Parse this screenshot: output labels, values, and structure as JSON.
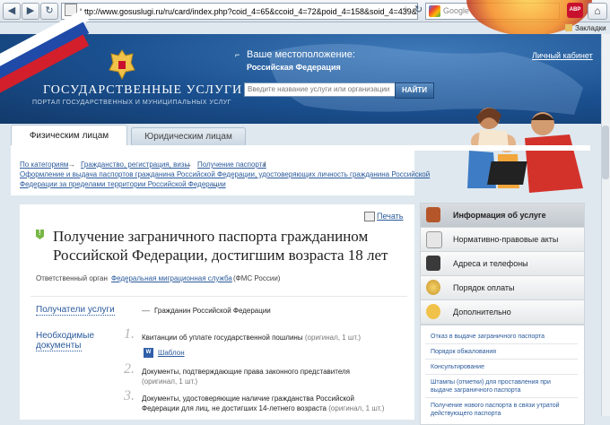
{
  "browser": {
    "url": "http://www.gosuslugi.ru/ru/card/index.php?coid_4=65&ccoid_4=72&poid_4=158&soid_4=439&tc",
    "search_placeholder": "Google",
    "addon_label": "ABP",
    "bookmarks_label": "Закладки"
  },
  "header": {
    "title": "ГОСУДАРСТВЕННЫЕ УСЛУГИ",
    "subtitle": "ПОРТАЛ ГОСУДАРСТВЕННЫХ И МУНИЦИПАЛЬНЫХ УСЛУГ",
    "location_label": "Ваше местоположение:",
    "location_value": "Российская Федерация",
    "cabinet_link": "Личный кабинет",
    "search_placeholder": "Введите название услуги или организации",
    "search_button": "НАЙТИ"
  },
  "tabs": [
    {
      "label": "Физическим лицам",
      "active": true
    },
    {
      "label": "Юридическим лицам",
      "active": false
    }
  ],
  "breadcrumbs": {
    "line1": [
      "По категориям",
      "Гражданство, регистрация, визы",
      "Получение паспорта"
    ],
    "line2": "Оформление и выдача паспортов гражданина Российской Федерации, удостоверяющих личность гражданина Российской",
    "line3": "Федерации за пределами территории Российской Федерации"
  },
  "main": {
    "print_label": "Печать",
    "title": "Получение заграничного паспорта гражданином Российской Федерации, достигшим возраста 18 лет",
    "org_label": "Ответственный орган",
    "org_link": "Федеральная миграционная служба",
    "org_abbr": "(ФМС России)",
    "recipients_label": "Получатели услуги",
    "recipients_value": "Гражданин Российской Федерации",
    "docs_label_1": "Необходимые",
    "docs_label_2": "документы",
    "docs": [
      {
        "num": "1.",
        "text": "Квитанции об уплате государственной пошлины",
        "note": "(оригинал, 1 шт.)",
        "template": "Шаблон"
      },
      {
        "num": "2.",
        "text": "Документы, подтверждающие права законного представителя",
        "note": "(оригинал, 1 шт.)"
      },
      {
        "num": "3.",
        "text": "Документы, удостоверяющие наличие гражданства Российской Федерации для лиц, не достигших 14-летнего возраста",
        "note": "(оригинал, 1 шт.)"
      }
    ]
  },
  "sidebar": {
    "items": [
      {
        "label": "Информация об услуге",
        "icon": "briefcase-icon",
        "color": "#b5562a"
      },
      {
        "label": "Нормативно-правовые акты",
        "icon": "document-icon",
        "color": "#e6e6e6"
      },
      {
        "label": "Адреса и телефоны",
        "icon": "phone-icon",
        "color": "#3a3a3a"
      },
      {
        "label": "Порядок оплаты",
        "icon": "coins-icon",
        "color": "#e0b13c"
      },
      {
        "label": "Дополнительно",
        "icon": "info-icon",
        "color": "#f0c24a"
      }
    ],
    "sub_items": [
      "Отказ в выдаче заграничного паспорта",
      "Порядок обжалования",
      "Консультирование",
      "Штампы (отметки) для проставления при",
      "выдаче заграничного паспорта",
      "Получение нового паспорта в связи утратой",
      "действующего паспорта"
    ]
  },
  "colors": {
    "header_blue": "#1a4f8e",
    "link": "#2a5a9b",
    "accent_green": "#78b646"
  }
}
